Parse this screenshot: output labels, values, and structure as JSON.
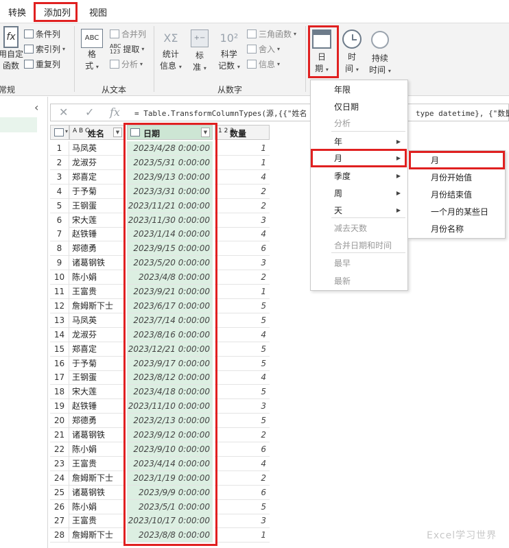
{
  "tabs": [
    "转换",
    "添加列",
    "视图"
  ],
  "ribbon": {
    "general": {
      "custom_func_line1": "用自定",
      "custom_func_line2": "函数",
      "conditional_col": "条件列",
      "index_col": "索引列",
      "duplicate_col": "重复列",
      "group": "常规"
    },
    "from_text": {
      "format_line1": "格",
      "format_line2": "式",
      "merge_cols": "合并列",
      "extract": "提取",
      "parse": "分析",
      "group": "从文本"
    },
    "from_number": {
      "statistics_line1": "统计",
      "statistics_line2": "信息",
      "standard_line1": "标",
      "standard_line2": "准",
      "scientific_line1": "科学",
      "scientific_line2": "记数",
      "trig": "三角函数",
      "rounding": "舍入",
      "info": "信息",
      "group": "从数字"
    },
    "from_datetime": {
      "date_line1": "日",
      "date_line2": "期",
      "time_line1": "时",
      "time_line2": "间",
      "duration_line1": "持续",
      "duration_line2": "时间"
    }
  },
  "formula": {
    "fx": "fx",
    "text": "= Table.TransformColumnTypes(源,{{\"姓名    ",
    "text2": "type datetime}, {\"数量"
  },
  "table": {
    "headers": {
      "name": "姓名",
      "date": "日期",
      "qty": "数量"
    },
    "type_icons": {
      "name": "A B C",
      "date": "calendar-clock",
      "qty": "1 2 3"
    },
    "rows": [
      [
        "1",
        "马凤英",
        "2023/4/28 0:00:00",
        "1"
      ],
      [
        "2",
        "龙淑芬",
        "2023/5/31 0:00:00",
        "1"
      ],
      [
        "3",
        "郑喜定",
        "2023/9/13 0:00:00",
        "4"
      ],
      [
        "4",
        "于予菊",
        "2023/3/31 0:00:00",
        "2"
      ],
      [
        "5",
        "王钢蛋",
        "2023/11/21 0:00:00",
        "2"
      ],
      [
        "6",
        "宋大莲",
        "2023/11/30 0:00:00",
        "3"
      ],
      [
        "7",
        "赵铁锤",
        "2023/1/14 0:00:00",
        "4"
      ],
      [
        "8",
        "郑德勇",
        "2023/9/15 0:00:00",
        "6"
      ],
      [
        "9",
        "诸葛钢铁",
        "2023/5/20 0:00:00",
        "3"
      ],
      [
        "10",
        "陈小娟",
        "2023/4/8 0:00:00",
        "2"
      ],
      [
        "11",
        "王富贵",
        "2023/9/21 0:00:00",
        "1"
      ],
      [
        "12",
        "詹姆斯下士",
        "2023/6/17 0:00:00",
        "5"
      ],
      [
        "13",
        "马凤英",
        "2023/7/14 0:00:00",
        "5"
      ],
      [
        "14",
        "龙淑芬",
        "2023/8/16 0:00:00",
        "4"
      ],
      [
        "15",
        "郑喜定",
        "2023/12/21 0:00:00",
        "5"
      ],
      [
        "16",
        "于予菊",
        "2023/9/17 0:00:00",
        "5"
      ],
      [
        "17",
        "王钢蛋",
        "2023/8/12 0:00:00",
        "4"
      ],
      [
        "18",
        "宋大莲",
        "2023/4/18 0:00:00",
        "5"
      ],
      [
        "19",
        "赵铁锤",
        "2023/11/10 0:00:00",
        "3"
      ],
      [
        "20",
        "郑德勇",
        "2023/2/13 0:00:00",
        "5"
      ],
      [
        "21",
        "诸葛钢铁",
        "2023/9/12 0:00:00",
        "2"
      ],
      [
        "22",
        "陈小娟",
        "2023/9/10 0:00:00",
        "6"
      ],
      [
        "23",
        "王富贵",
        "2023/4/14 0:00:00",
        "4"
      ],
      [
        "24",
        "詹姆斯下士",
        "2023/1/19 0:00:00",
        "2"
      ],
      [
        "25",
        "诸葛钢铁",
        "2023/9/9 0:00:00",
        "6"
      ],
      [
        "26",
        "陈小娟",
        "2023/5/1 0:00:00",
        "5"
      ],
      [
        "27",
        "王富贵",
        "2023/10/17 0:00:00",
        "3"
      ],
      [
        "28",
        "詹姆斯下士",
        "2023/8/8 0:00:00",
        "1"
      ]
    ]
  },
  "date_menu": {
    "items": [
      {
        "label": "年限",
        "disabled": false,
        "submenu": false
      },
      {
        "label": "仅日期",
        "disabled": false,
        "submenu": false
      },
      {
        "label": "分析",
        "disabled": true,
        "submenu": false
      },
      {
        "label": "年",
        "disabled": false,
        "submenu": true
      },
      {
        "label": "月",
        "disabled": false,
        "submenu": true
      },
      {
        "label": "季度",
        "disabled": false,
        "submenu": true
      },
      {
        "label": "周",
        "disabled": false,
        "submenu": true
      },
      {
        "label": "天",
        "disabled": false,
        "submenu": true
      },
      {
        "label": "减去天数",
        "disabled": true,
        "submenu": false
      },
      {
        "label": "合并日期和时间",
        "disabled": true,
        "submenu": false
      },
      {
        "label": "最早",
        "disabled": true,
        "submenu": false
      },
      {
        "label": "最新",
        "disabled": true,
        "submenu": false
      }
    ]
  },
  "month_submenu": {
    "items": [
      "月",
      "月份开始值",
      "月份结束值",
      "一个月的某些日",
      "月份名称"
    ]
  },
  "watermark": "Excel学习世界",
  "colors": {
    "highlight_red": "#e02020",
    "date_column_fill": "#dcefe2",
    "ribbon_bg": "#f3f3f3"
  }
}
